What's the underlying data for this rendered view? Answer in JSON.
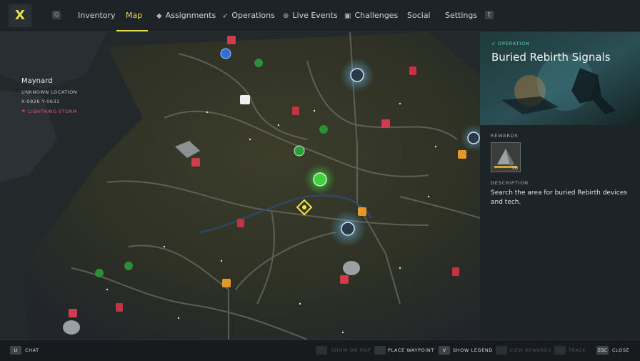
{
  "nav": {
    "logo": "X",
    "left_key": "Q",
    "right_key": "E",
    "tabs": [
      {
        "label": "Inventory",
        "icon": ""
      },
      {
        "label": "Map",
        "icon": ""
      },
      {
        "label": "Assignments",
        "icon": "diamond-icon"
      },
      {
        "label": "Operations",
        "icon": "rocket-icon"
      },
      {
        "label": "Live Events",
        "icon": "globe-icon"
      },
      {
        "label": "Challenges",
        "icon": "chest-icon"
      },
      {
        "label": "Social",
        "icon": ""
      },
      {
        "label": "Settings",
        "icon": ""
      }
    ],
    "active_tab": "Map",
    "accent_color": "#e3dd48"
  },
  "location": {
    "name": "Maynard",
    "sublabel": "UNKNOWN LOCATION",
    "coords": "X-0926 Y-0631",
    "weather": "LIGHTNING STORM",
    "weather_color": "#ff4f6a"
  },
  "panel": {
    "type_label": "OPERATION",
    "title": "Buried Rebirth Signals",
    "rewards_label": "REWARDS",
    "reward_count": "10",
    "description_label": "DESCRIPTION",
    "description": "Search the area for buried Rebirth devices and tech."
  },
  "bottom": {
    "actions": [
      {
        "key": "U",
        "label": "CHAT",
        "enabled": true
      },
      {
        "key": "",
        "label": "SHOW ON MAP",
        "enabled": false
      },
      {
        "key": "",
        "label": "PLACE WAYPOINT",
        "enabled": true
      },
      {
        "key": "V",
        "label": "SHOW LEGEND",
        "enabled": true
      },
      {
        "key": "",
        "label": "VIEW REWARDS",
        "enabled": false
      },
      {
        "key": "",
        "label": "TRACK",
        "enabled": false
      },
      {
        "key": "ESC",
        "label": "CLOSE",
        "enabled": true
      }
    ]
  }
}
